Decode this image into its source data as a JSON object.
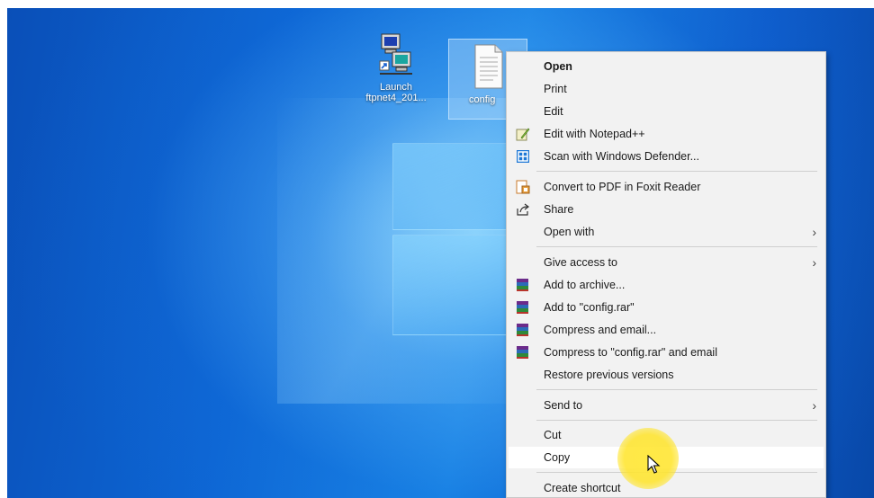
{
  "desktop": {
    "icons": [
      {
        "label_line1": "Launch",
        "label_line2": "ftpnet4_201..."
      },
      {
        "label_line1": "config"
      }
    ]
  },
  "context_menu": {
    "items": [
      {
        "label": "Open",
        "icon": "none",
        "bold": true
      },
      {
        "label": "Print",
        "icon": "none"
      },
      {
        "label": "Edit",
        "icon": "none"
      },
      {
        "label": "Edit with Notepad++",
        "icon": "notepadpp-icon"
      },
      {
        "label": "Scan with Windows Defender...",
        "icon": "windows-defender-icon"
      },
      {
        "label": "Convert to PDF in Foxit Reader",
        "icon": "foxit-pdf-icon"
      },
      {
        "label": "Share",
        "icon": "share-icon"
      },
      {
        "label": "Open with",
        "icon": "none",
        "submenu": true
      },
      {
        "label": "Give access to",
        "icon": "none",
        "submenu": true
      },
      {
        "label": "Add to archive...",
        "icon": "winrar-icon"
      },
      {
        "label": "Add to \"config.rar\"",
        "icon": "winrar-icon"
      },
      {
        "label": "Compress and email...",
        "icon": "winrar-icon"
      },
      {
        "label": "Compress to \"config.rar\" and email",
        "icon": "winrar-icon"
      },
      {
        "label": "Restore previous versions",
        "icon": "none"
      },
      {
        "label": "Send to",
        "icon": "none",
        "submenu": true
      },
      {
        "label": "Cut",
        "icon": "none"
      },
      {
        "label": "Copy",
        "icon": "none",
        "hovered": true
      },
      {
        "label": "Create shortcut",
        "icon": "none"
      }
    ],
    "submenu_arrow": "›"
  },
  "colors": {
    "desktop_blue": "#0d66d4",
    "menu_bg": "#f2f2f2",
    "hover_bg": "#ffffff",
    "cursor_highlight": "#ffe83c"
  }
}
